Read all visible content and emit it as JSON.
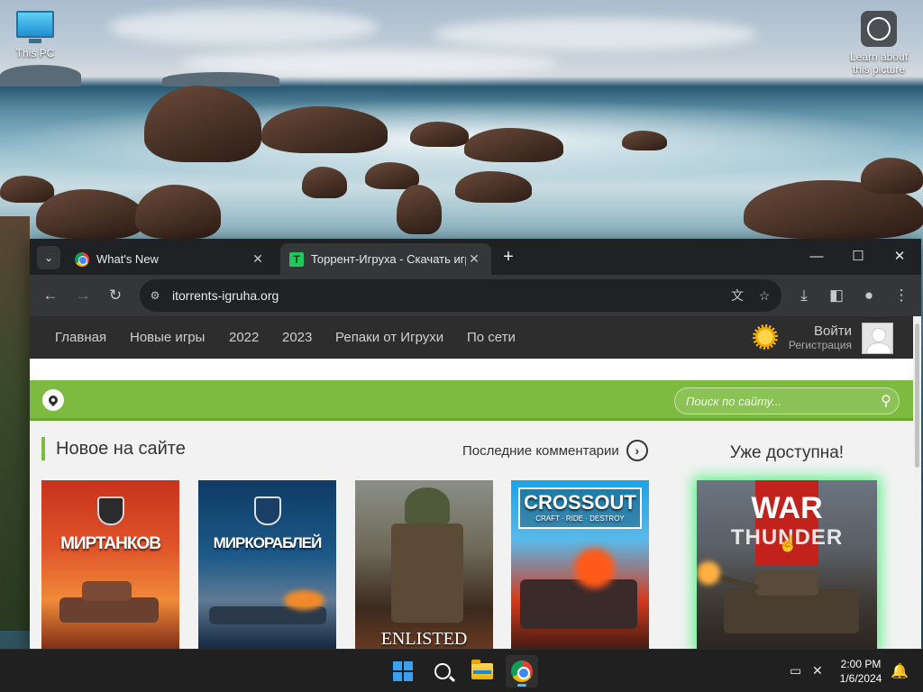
{
  "desktop": {
    "icons": [
      {
        "label": "This PC",
        "icon": "computer-icon"
      },
      {
        "label": "Learn about this picture",
        "icon": "camera-info-icon"
      }
    ]
  },
  "browser": {
    "tabs": [
      {
        "title": "What's New",
        "favicon": "chrome-icon",
        "active": false
      },
      {
        "title": "Торрент-Игруха - Скачать игр",
        "favicon": "torrent-igruha-icon",
        "active": true
      }
    ],
    "address": "itorrents-igruha.org"
  },
  "site": {
    "nav": [
      "Главная",
      "Новые игры",
      "2022",
      "2023",
      "Репаки от Игрухи",
      "По сети"
    ],
    "login": "Войти",
    "register": "Регистрация",
    "search_placeholder": "Поиск по сайту...",
    "section_title": "Новое на сайте",
    "comments_link": "Последние комментарии",
    "available_title": "Уже доступна!",
    "cards": [
      {
        "title": "МИРТАНКОВ"
      },
      {
        "title": "МИРКОРАБЛЕЙ"
      },
      {
        "title": "ENLISTED"
      },
      {
        "title": "CROSSOUT",
        "subtitle": "CRAFT · RIDE · DESTROY"
      }
    ],
    "featured": {
      "line1": "WAR",
      "line2": "THUNDER"
    },
    "accent_color": "#7cbb3f"
  },
  "taskbar": {
    "apps": [
      "start-icon",
      "search-icon",
      "file-explorer-icon",
      "chrome-icon"
    ],
    "time": "2:00 PM",
    "date": "1/6/2024"
  }
}
